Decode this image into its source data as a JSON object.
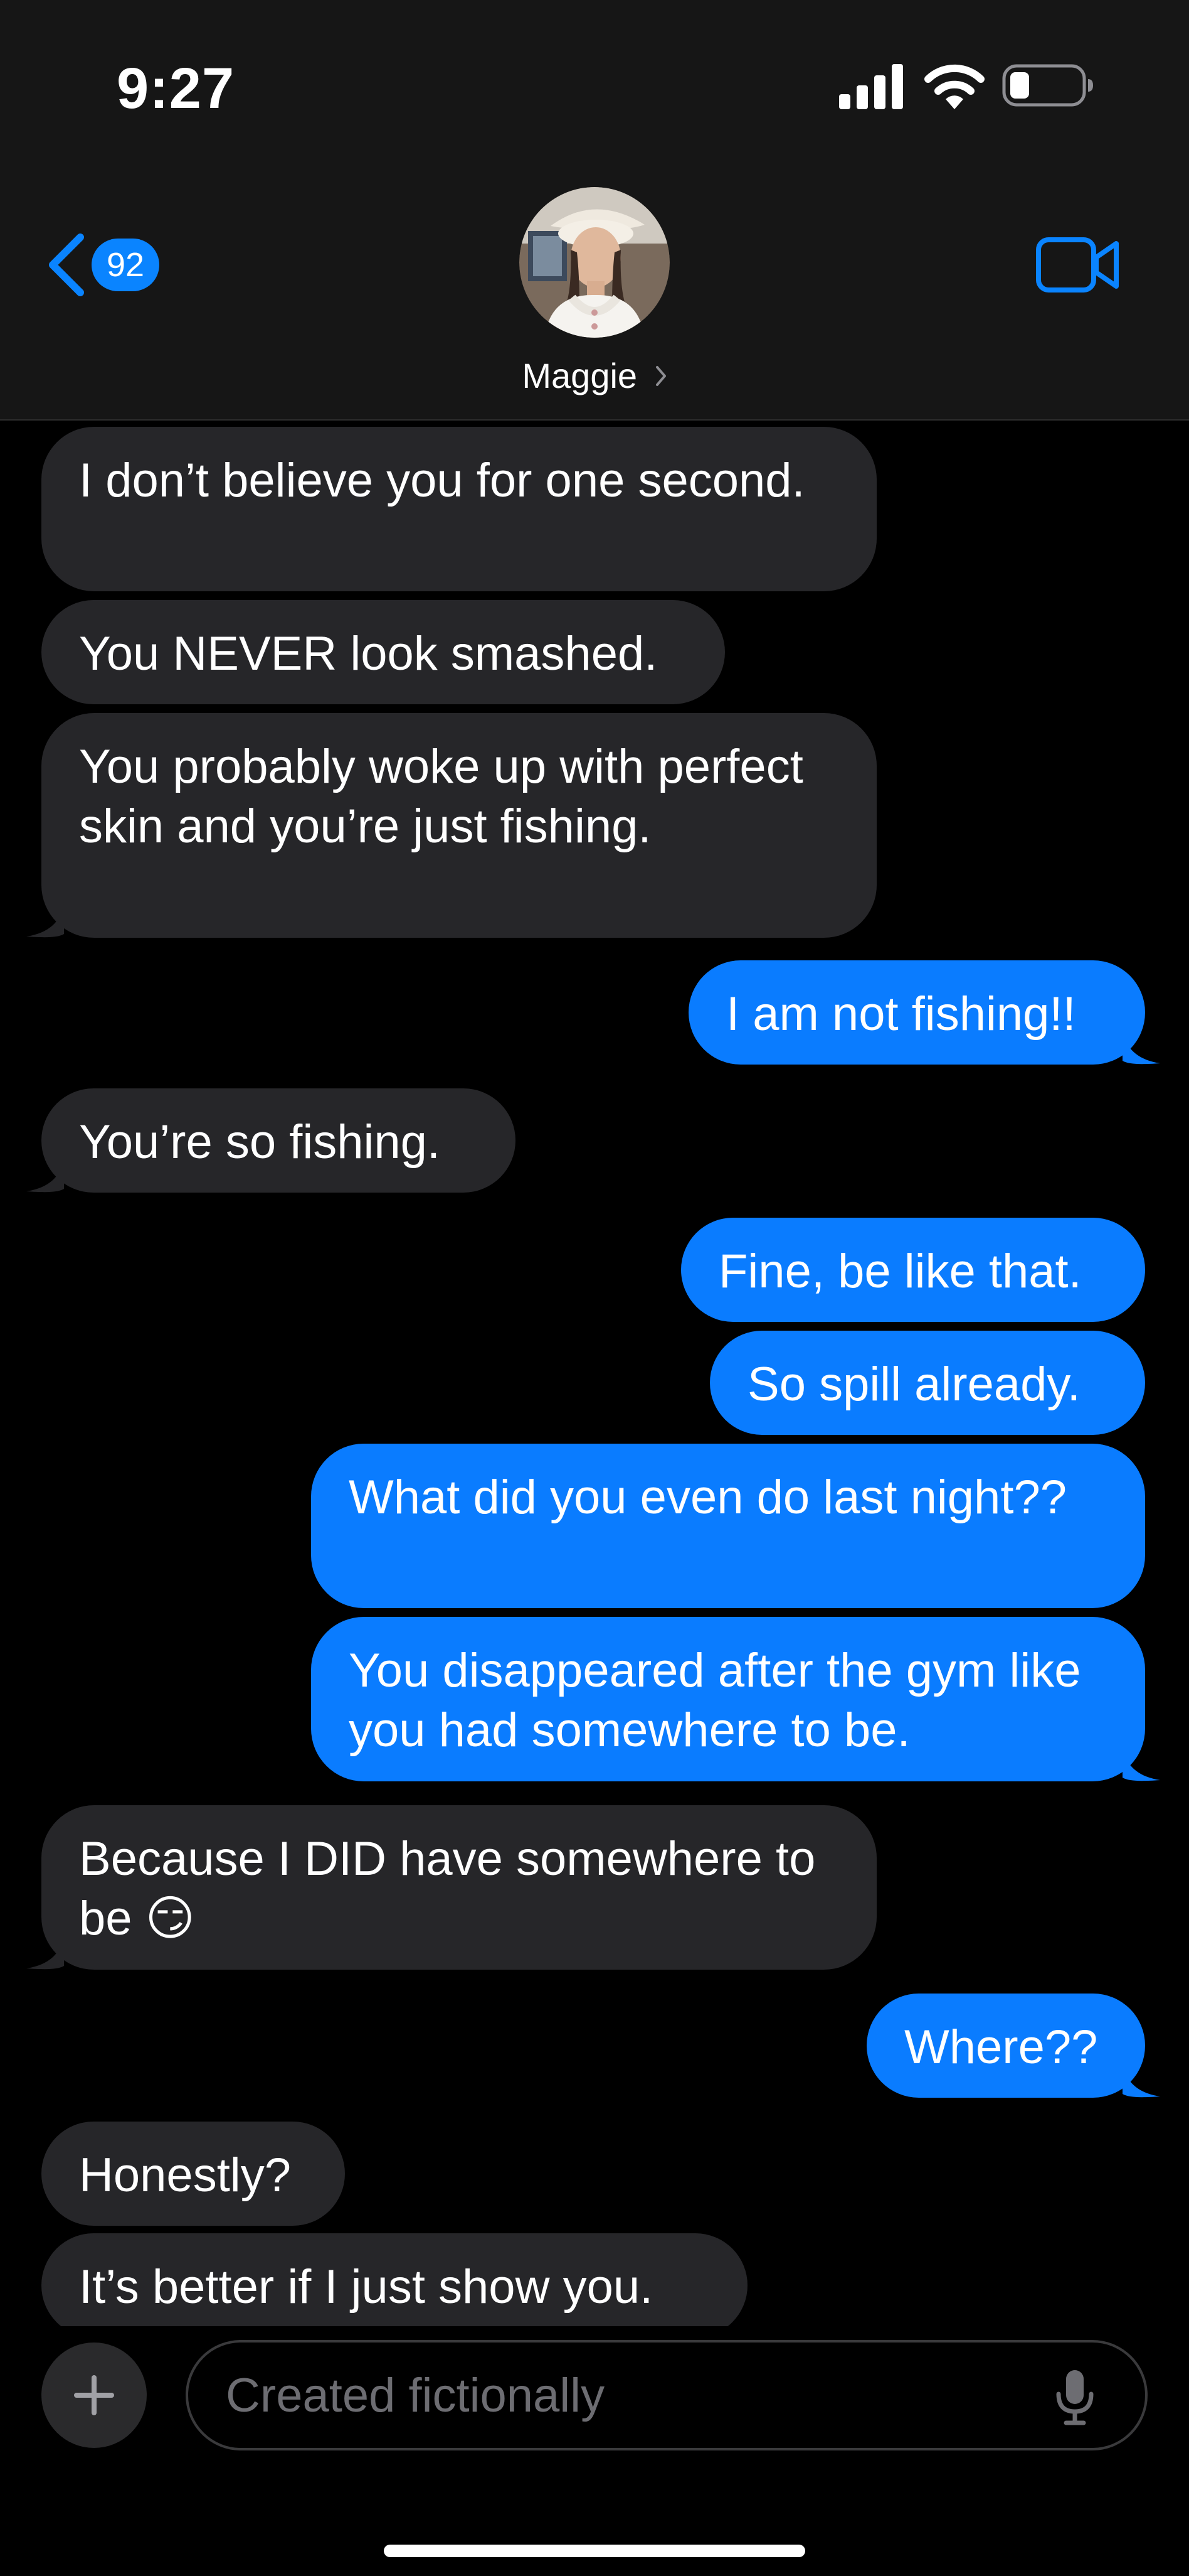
{
  "status_bar": {
    "time": "9:27"
  },
  "header": {
    "unread_count": "92",
    "contact_name": "Maggie",
    "back_icon": "chevron-left-icon",
    "video_icon": "video-camera-icon"
  },
  "messages": [
    {
      "side": "in",
      "text": "I don’t believe you for one second."
    },
    {
      "side": "in",
      "text": "You NEVER look smashed."
    },
    {
      "side": "in",
      "text": "You probably woke up with perfect skin and you’re just fishing."
    },
    {
      "side": "out",
      "text": "I am not fishing!!"
    },
    {
      "side": "in",
      "text": "You’re so fishing."
    },
    {
      "side": "out",
      "text": "Fine, be like that."
    },
    {
      "side": "out",
      "text": "So spill already."
    },
    {
      "side": "out",
      "text": "What did you even do last night??"
    },
    {
      "side": "out",
      "text": "You disappeared after the gym like you had somewhere to be."
    },
    {
      "side": "in",
      "text": "Because I DID have somewhere to be 😏"
    },
    {
      "side": "out",
      "text": "Where??"
    },
    {
      "side": "in",
      "text": "Honestly?"
    },
    {
      "side": "in",
      "text": "It’s better if I just show you."
    }
  ],
  "composer": {
    "placeholder": "Created fictionally",
    "plus_icon": "plus-icon",
    "mic_icon": "microphone-icon"
  },
  "colors": {
    "incoming_bubble": "#262629",
    "outgoing_bubble": "#0a7cff",
    "accent": "#0a84ff",
    "header_bg": "#161616"
  }
}
